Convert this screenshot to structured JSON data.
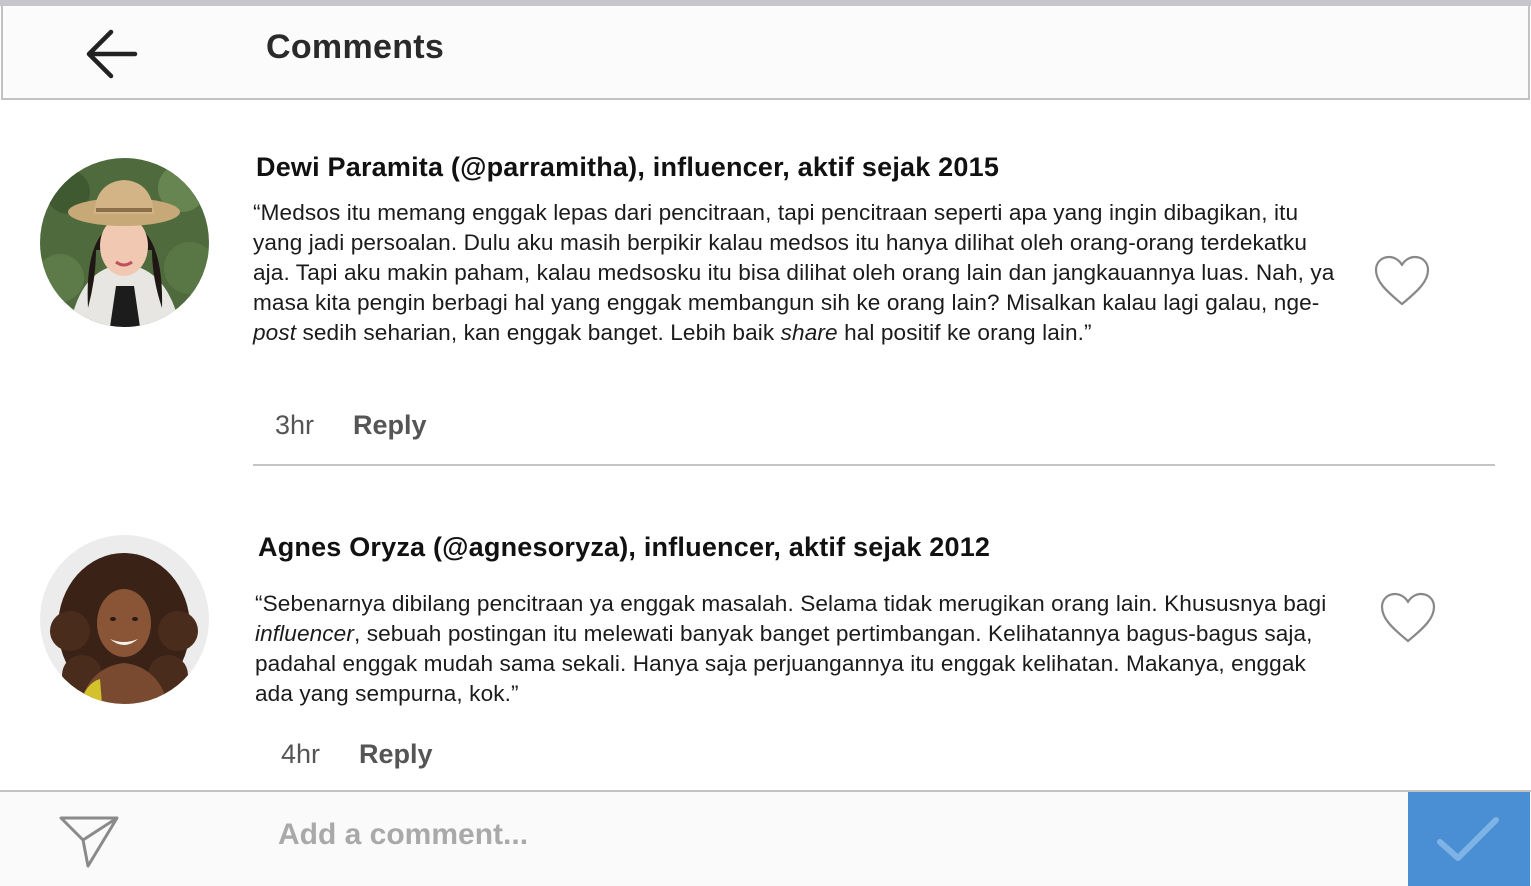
{
  "header": {
    "back_icon": "arrow-left-icon",
    "title": "Comments"
  },
  "comments": [
    {
      "avatar_icon": "avatar-photo",
      "author": "Dewi Paramita (@parramitha), influencer, aktif sejak 2015",
      "text_parts": [
        {
          "t": "“Medsos itu memang enggak lepas dari pencitraan, tapi pencitraan seperti apa yang ingin dibagikan, itu yang jadi persoalan. Dulu aku masih berpikir kalau medsos itu hanya dilihat oleh orang-orang terdekatku aja. Tapi aku makin paham, kalau medsosku itu bisa dilihat oleh orang lain dan jangkauannya luas. Nah, ya masa kita pengin berbagi hal yang enggak membangun sih ke orang lain? Misalkan kalau lagi galau, nge-",
          "i": false
        },
        {
          "t": "post",
          "i": true
        },
        {
          "t": " sedih seharian, kan enggak banget. Lebih baik ",
          "i": false
        },
        {
          "t": "share",
          "i": true
        },
        {
          "t": " hal positif ke orang lain.”",
          "i": false
        }
      ],
      "time": "3hr",
      "reply_label": "Reply",
      "like_icon": "heart-outline-icon"
    },
    {
      "avatar_icon": "avatar-photo",
      "author": "Agnes Oryza (@agnesoryza), influencer, aktif sejak 2012",
      "text_parts": [
        {
          "t": "“Sebenarnya dibilang pencitraan ya enggak masalah. Selama tidak merugikan orang lain. Khususnya bagi ",
          "i": false
        },
        {
          "t": "influencer",
          "i": true
        },
        {
          "t": ", sebuah postingan itu melewati banyak banget pertimbangan. Kelihatannya bagus-bagus saja, padahal enggak mudah sama sekali. Hanya saja perjuangannya itu enggak kelihatan. Makanya, enggak ada yang sempurna, kok.”",
          "i": false
        }
      ],
      "time": "4hr",
      "reply_label": "Reply",
      "like_icon": "heart-outline-icon"
    }
  ],
  "composer": {
    "send_icon": "paper-plane-icon",
    "placeholder": "Add a comment...",
    "value": "",
    "submit_icon": "checkmark-icon"
  },
  "colors": {
    "accent": "#4a8fd3",
    "border": "#c2c2c2",
    "meta_text": "#555555",
    "placeholder": "#a9a9a9"
  }
}
